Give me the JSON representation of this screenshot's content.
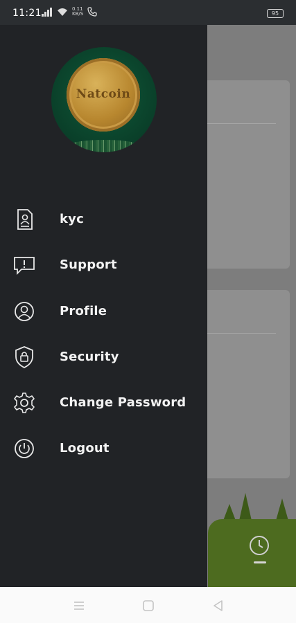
{
  "status_bar": {
    "time": "11:21",
    "network_speed": "0.11",
    "network_unit": "KB/S",
    "battery": "95"
  },
  "app": {
    "logo_text": "Natcoin"
  },
  "menu": {
    "items": [
      {
        "label": "kyc",
        "icon": "id-document-icon"
      },
      {
        "label": "Support",
        "icon": "chat-alert-icon"
      },
      {
        "label": "Profile",
        "icon": "user-circle-icon"
      },
      {
        "label": "Security",
        "icon": "shield-lock-icon"
      },
      {
        "label": "Change Password",
        "icon": "gear-icon"
      },
      {
        "label": "Logout",
        "icon": "power-icon"
      }
    ]
  },
  "colors": {
    "drawer_bg": "#212326",
    "status_bg": "#2b2e31",
    "text": "#f2f2f2",
    "accent_green": "#4d6b1f"
  }
}
